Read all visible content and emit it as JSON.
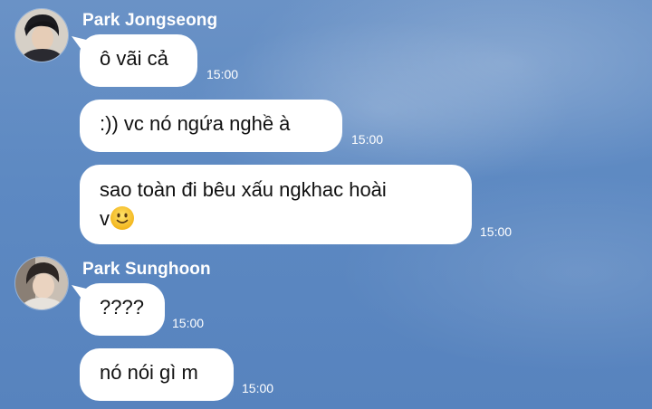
{
  "chat": {
    "groups": [
      {
        "sender": "Park Jongseong",
        "messages": [
          {
            "text": "ô vãi cả",
            "time": "15:00"
          },
          {
            "text": ":)) vc nó ngứa nghề à",
            "time": "15:00"
          },
          {
            "text_line1": "sao toàn đi bêu xấu ngkhac hoài",
            "text_line2": "v",
            "emoji": "slightly-smiling-face-emoji",
            "time": "15:00"
          }
        ]
      },
      {
        "sender": "Park Sunghoon",
        "messages": [
          {
            "text": "????",
            "time": "15:00"
          },
          {
            "text": "nó nói gì m",
            "time": "15:00"
          }
        ]
      }
    ]
  },
  "colors": {
    "background": "#5d89c2",
    "bubble": "#ffffff",
    "sender_text": "#ffffff"
  }
}
